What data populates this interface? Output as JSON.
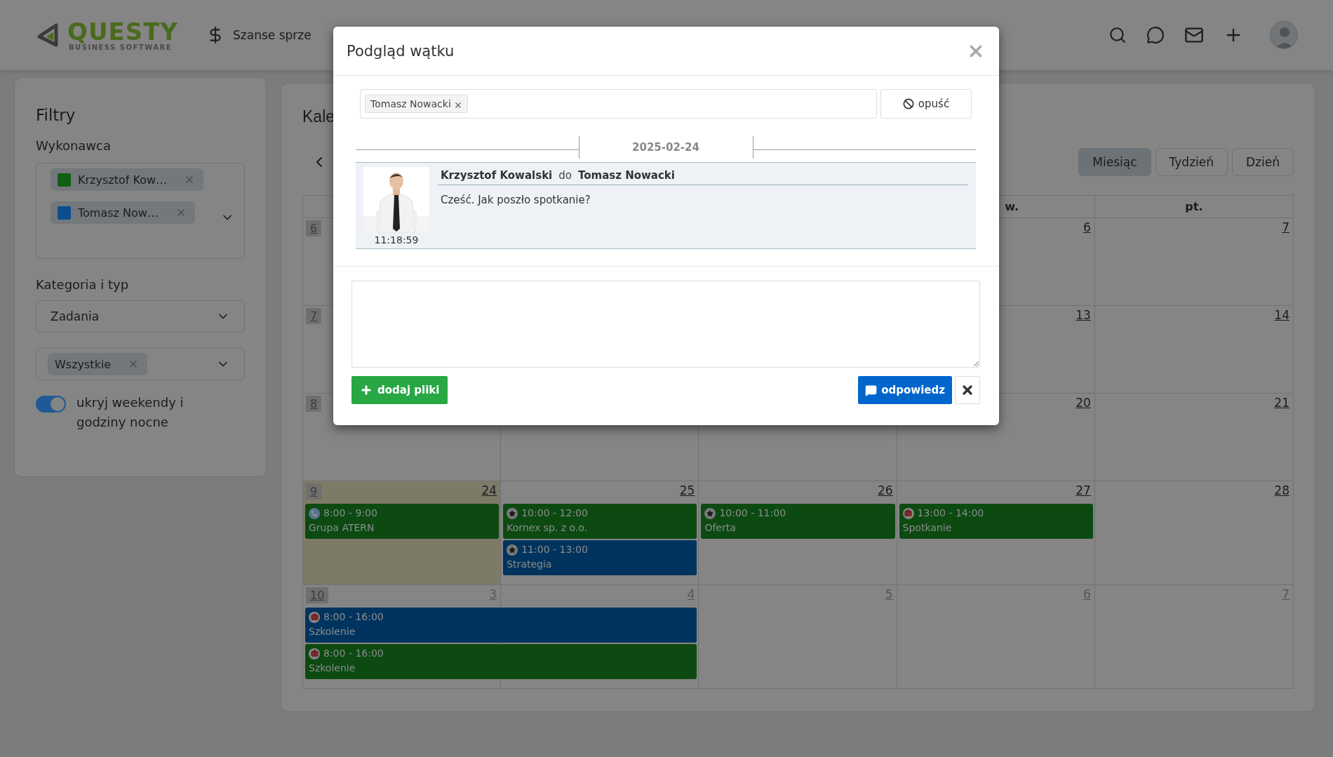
{
  "header": {
    "logo": {
      "name": "QUESTY",
      "tagline": "BUSINESS SOFTWARE"
    },
    "nav": [
      {
        "label": "Szanse sprze"
      }
    ]
  },
  "filters": {
    "title": "Filtry",
    "assignee": {
      "label": "Wykonawca",
      "chips": [
        {
          "label": "Krzysztof Kow…",
          "color": "#0f5f16"
        },
        {
          "label": "Tomasz Now…",
          "color": "#0a4e8f"
        }
      ]
    },
    "category": {
      "label": "Kategoria i typ",
      "select": "Zadania",
      "type_chips": [
        {
          "label": "Wszystkie"
        }
      ]
    },
    "toggle": {
      "label": "ukryj weekendy i godziny nocne",
      "on": true
    }
  },
  "calendar": {
    "title": "Kale",
    "views": [
      {
        "label": "Miesiąc",
        "selected": true
      },
      {
        "label": "Tydzień",
        "selected": false
      },
      {
        "label": "Dzień",
        "selected": false
      }
    ],
    "columns": [
      {},
      {},
      {},
      {
        "label": "w."
      },
      {
        "label": "pt."
      }
    ],
    "weeks": [
      {
        "week": "6",
        "days": [
          {
            "number": "6",
            "today": false,
            "other_month": false
          },
          {
            "number": "7",
            "today": false,
            "other_month": false
          }
        ]
      },
      {
        "week": "7",
        "days": [
          {
            "number": "13",
            "today": false,
            "other_month": false
          },
          {
            "number": "14",
            "today": false,
            "other_month": false
          }
        ]
      },
      {
        "week": "8",
        "days": [
          {
            "number": "20",
            "today": false,
            "other_month": false
          },
          {
            "number": "21",
            "today": false,
            "other_month": false
          }
        ]
      },
      {
        "week": "9",
        "days": [
          {
            "number": "24",
            "today": true,
            "other_month": false,
            "events": [
              {
                "time": "8:00 - 9:00",
                "title": "Grupa ATERN",
                "kind": "phone",
                "color": "#0c4a12",
                "spans_next_day": false
              }
            ]
          },
          {
            "number": "25",
            "today": false,
            "other_month": false,
            "events": [
              {
                "time": "10:00 - 12:00",
                "title": "Kornex sp. z o.o.",
                "kind": "star",
                "color": "#0c4a12",
                "spans_next_day": false
              },
              {
                "time": "11:00 - 13:00",
                "title": "Strategia",
                "kind": "star",
                "color": "#00345e",
                "spans_next_day": false
              }
            ]
          },
          {
            "number": "26",
            "today": false,
            "other_month": false,
            "events": [
              {
                "time": "10:00 - 11:00",
                "title": "Oferta",
                "kind": "star",
                "color": "#0c4a12",
                "spans_next_day": false
              }
            ]
          },
          {
            "number": "27",
            "today": false,
            "other_month": false,
            "events": [
              {
                "time": "13:00 - 14:00",
                "title": "Spotkanie",
                "kind": "briefcase",
                "color": "#0c4a12",
                "spans_next_day": false
              }
            ]
          },
          {
            "number": "28",
            "today": false,
            "other_month": false
          }
        ]
      },
      {
        "week": "10",
        "days": [
          {
            "number": "3",
            "today": false,
            "other_month": true,
            "events": [
              {
                "time": "8:00 - 16:00",
                "title": "Szkolenie",
                "kind": "briefcase",
                "color": "#00345e",
                "spans_next_day": true
              },
              {
                "time": "8:00 - 16:00",
                "title": "Szkolenie",
                "kind": "briefcase",
                "color": "#0c4a12",
                "spans_next_day": true
              }
            ]
          },
          {
            "number": "4",
            "today": false,
            "other_month": true
          },
          {
            "number": "5",
            "today": false,
            "other_month": true
          },
          {
            "number": "6",
            "today": false,
            "other_month": true
          },
          {
            "number": "7",
            "today": false,
            "other_month": true
          }
        ]
      }
    ]
  },
  "thread_modal": {
    "title": "Podgląd wątku",
    "recipients": [
      {
        "label": "Tomasz Nowacki"
      }
    ],
    "leave_button": "opuść",
    "date": "2025-02-24",
    "messages": [
      {
        "author": "Krzysztof Kowalski",
        "to_word": "do",
        "recipient": "Tomasz Nowacki",
        "time": "11:18:59",
        "text": "Cześć. Jak poszło spotkanie?"
      }
    ],
    "reply": {
      "add_files": "dodaj pliki",
      "send": "odpowiedz"
    }
  }
}
